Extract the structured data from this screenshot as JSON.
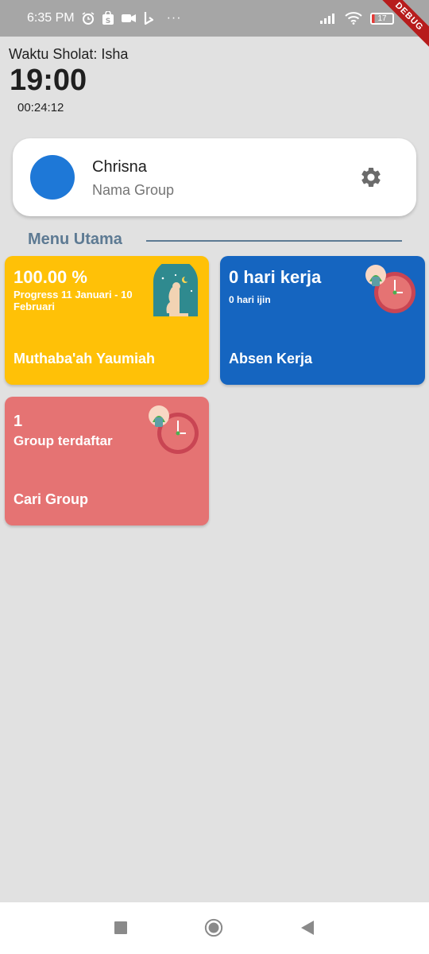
{
  "status_bar": {
    "time": "6:35 PM",
    "icons": [
      "alarm-icon",
      "shop-icon",
      "video-icon",
      "b-icon",
      "more-icon"
    ],
    "more": "···",
    "battery": "17",
    "debug": "DEBUG"
  },
  "prayer": {
    "label": "Waktu Sholat: Isha",
    "time": "19:00",
    "countdown": "00:24:12"
  },
  "profile": {
    "name": "Chrisna",
    "group": "Nama Group",
    "avatar_color": "#1e78d7"
  },
  "menu": {
    "title": "Menu Utama",
    "tiles": [
      {
        "big": "100.00 %",
        "small": "Progress 11 Januari - 10 Februari",
        "label": "Muthaba'ah Yaumiah",
        "color": "#ffc107",
        "icon": "mosque-prayer-icon"
      },
      {
        "big": "0 hari kerja",
        "small": "0 hari ijin",
        "label": "Absen Kerja",
        "color": "#1565c0",
        "icon": "clock-person-icon"
      },
      {
        "big": "1",
        "small": "Group terdaftar",
        "label": "Cari Group",
        "color": "#e57373",
        "icon": "clock-person-icon"
      }
    ]
  },
  "nav": {
    "buttons": [
      "recent-apps-icon",
      "home-icon",
      "back-icon"
    ]
  }
}
